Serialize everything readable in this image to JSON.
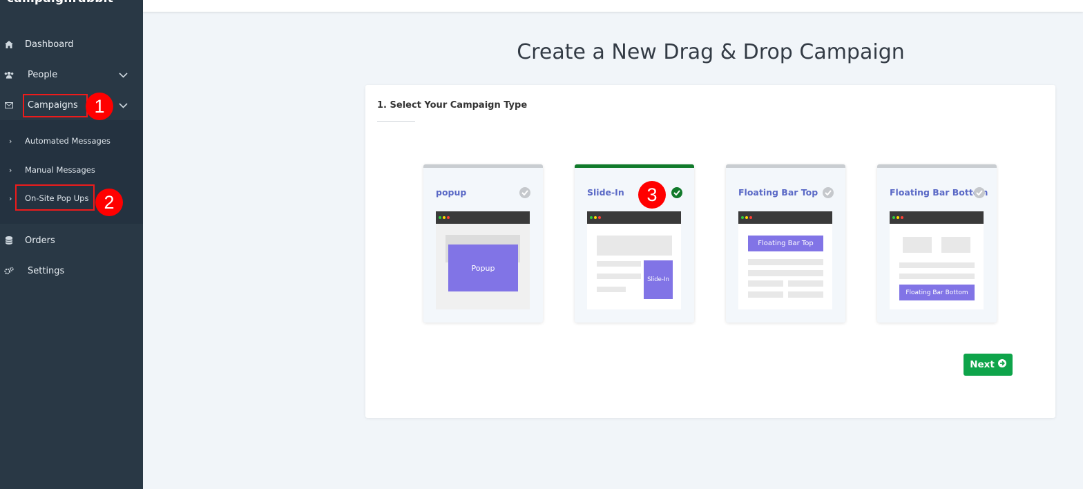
{
  "app": {
    "logo_text": "campaignrabbit"
  },
  "sidebar": {
    "items": [
      {
        "label": "Dashboard",
        "icon": "home-icon"
      },
      {
        "label": "People",
        "icon": "users-icon"
      },
      {
        "label": "Campaigns",
        "icon": "envelope-icon"
      },
      {
        "label": "Orders",
        "icon": "database-icon"
      },
      {
        "label": "Settings",
        "icon": "gears-icon"
      }
    ],
    "campaign_submenu": [
      {
        "label": "Automated Messages"
      },
      {
        "label": "Manual Messages"
      },
      {
        "label": "On-Site Pop Ups"
      }
    ]
  },
  "annotations": [
    "1",
    "2",
    "3"
  ],
  "main": {
    "title": "Create a New Drag & Drop Campaign",
    "step_title": "1. Select Your Campaign Type",
    "campaign_types": [
      {
        "name": "popup",
        "preview_label": "Popup",
        "selected": false
      },
      {
        "name": "Slide-In",
        "preview_label": "Slide-In",
        "selected": true
      },
      {
        "name": "Floating Bar Top",
        "preview_label": "Floating Bar Top",
        "selected": false
      },
      {
        "name": "Floating Bar Bottom",
        "preview_label": "Floating Bar Bottom",
        "selected": false
      }
    ],
    "next_label": "Next"
  },
  "colors": {
    "sidebar": "#293845",
    "accent_purple": "#8174e6",
    "selected_green": "#117a2b",
    "next_button": "#0ea44a",
    "annotation_red": "#ff0000"
  }
}
